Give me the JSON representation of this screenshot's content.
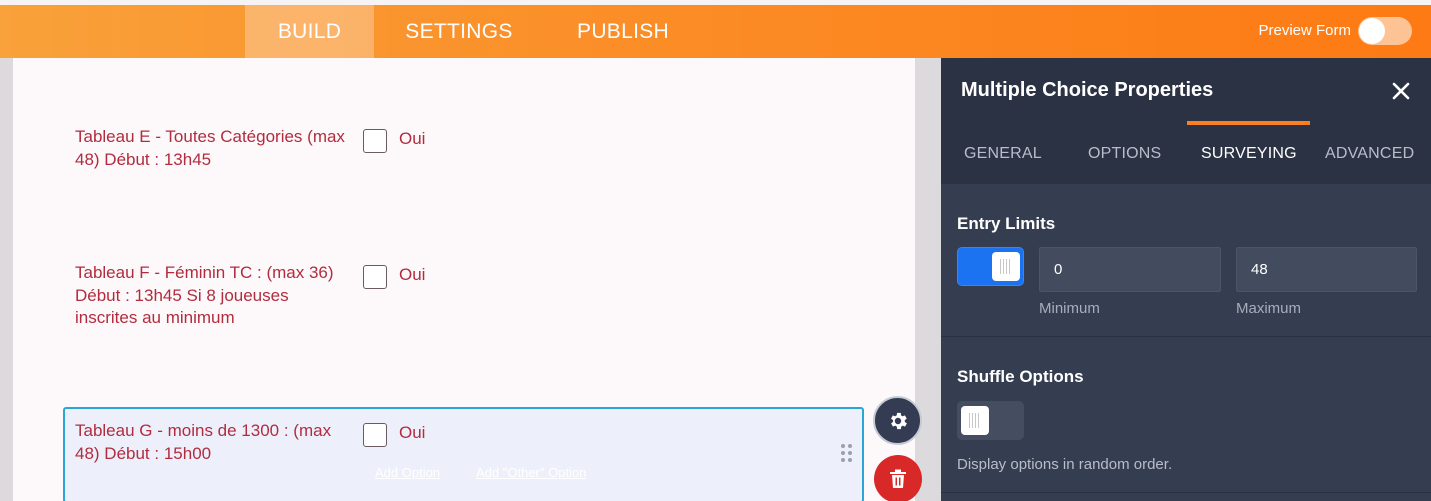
{
  "topbar": {
    "tabs": [
      "BUILD",
      "SETTINGS",
      "PUBLISH"
    ],
    "preview_label": "Preview Form",
    "preview_on": false
  },
  "form": {
    "fields": [
      {
        "label": "Tableau E - Toutes Catégories (max 48) Début : 13h45",
        "option": "Oui"
      },
      {
        "label": "Tableau F - Féminin TC : (max 36) Début : 13h45 Si 8 joueuses inscrites au minimum",
        "option": "Oui"
      },
      {
        "label": "Tableau G - moins de 1300 : (max 48) Début : 15h00",
        "option": "Oui"
      }
    ],
    "add_option_label": "Add Option",
    "add_other_label": "Add \"Other\" Option"
  },
  "panel": {
    "title": "Multiple Choice Properties",
    "tabs": [
      "GENERAL",
      "OPTIONS",
      "SURVEYING",
      "ADVANCED"
    ],
    "active_tab": "SURVEYING",
    "entry_limits": {
      "title": "Entry Limits",
      "enabled": true,
      "minimum_value": "0",
      "maximum_value": "48",
      "minimum_label": "Minimum",
      "maximum_label": "Maximum"
    },
    "shuffle": {
      "title": "Shuffle Options",
      "enabled": false,
      "hint": "Display options in random order."
    }
  },
  "colors": {
    "accent": "#fb7f22",
    "label_red": "#b12c3e",
    "toggle_blue": "#1b73f1",
    "panel_bg": "#353d50"
  }
}
